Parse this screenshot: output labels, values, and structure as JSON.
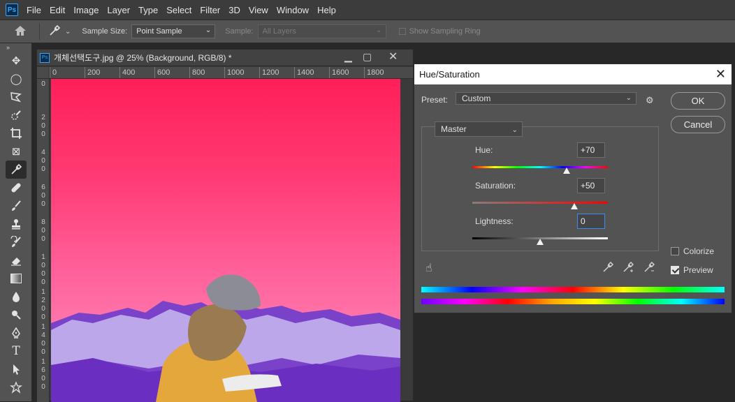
{
  "menubar": {
    "logo": "Ps",
    "items": [
      "File",
      "Edit",
      "Image",
      "Layer",
      "Type",
      "Select",
      "Filter",
      "3D",
      "View",
      "Window",
      "Help"
    ]
  },
  "options": {
    "sample_size_label": "Sample Size:",
    "sample_size_value": "Point Sample",
    "sample_label": "Sample:",
    "sample_value": "All Layers",
    "show_ring_label": "Show Sampling Ring"
  },
  "toolbar": {
    "grip": "»",
    "tools": [
      "move-tool",
      "ellipse-marquee-tool",
      "polygon-lasso-tool",
      "quick-selection-tool",
      "crop-tool",
      "frame-tool",
      "eyedropper-tool",
      "healing-brush-tool",
      "brush-tool",
      "clone-stamp-tool",
      "history-brush-tool",
      "eraser-tool",
      "gradient-tool",
      "blur-tool",
      "dodge-tool",
      "pen-tool",
      "type-tool",
      "path-selection-tool",
      "shape-tool"
    ],
    "active_tool": "eyedropper-tool"
  },
  "document": {
    "title": "개체선택도구.jpg @ 25% (Background, RGB/8) *",
    "ruler_top": [
      "0",
      "200",
      "400",
      "600",
      "800",
      "1000",
      "1200",
      "1400",
      "1600",
      "1800"
    ],
    "ruler_left": [
      "0",
      "2\n0\n0",
      "4\n0\n0",
      "6\n0\n0",
      "8\n0\n0",
      "1\n0\n0\n0",
      "1\n2\n0\n0",
      "1\n4\n0\n0",
      "1\n6\n0\n0"
    ]
  },
  "dialog": {
    "title": "Hue/Saturation",
    "preset_label": "Preset:",
    "preset_value": "Custom",
    "channel_value": "Master",
    "hue_label": "Hue:",
    "hue_value": "+70",
    "saturation_label": "Saturation:",
    "saturation_value": "+50",
    "lightness_label": "Lightness:",
    "lightness_value": "0",
    "ok_label": "OK",
    "cancel_label": "Cancel",
    "colorize_label": "Colorize",
    "colorize_checked": false,
    "preview_label": "Preview",
    "preview_checked": true,
    "hue_slider": 70,
    "saturation_slider": 50,
    "lightness_slider": 0
  }
}
